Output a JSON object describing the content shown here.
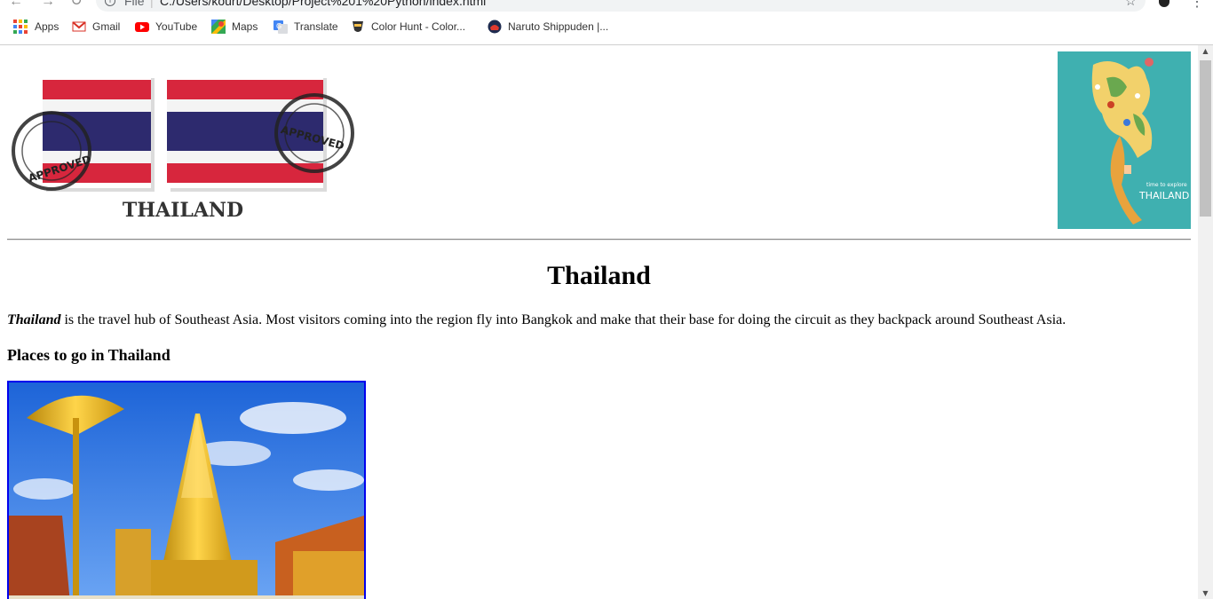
{
  "browser": {
    "omnibox": {
      "scheme_label": "File",
      "separator": "|",
      "url": "C:/Users/kourt/Desktop/Project%201%20Python/index.html"
    },
    "bookmarks": [
      {
        "label": "Apps",
        "icon": "apps-grid-icon"
      },
      {
        "label": "Gmail",
        "icon": "gmail-icon"
      },
      {
        "label": "YouTube",
        "icon": "youtube-icon"
      },
      {
        "label": "Maps",
        "icon": "maps-icon"
      },
      {
        "label": "Translate",
        "icon": "translate-icon"
      },
      {
        "label": "Color Hunt - Color...",
        "icon": "color-hunt-icon"
      },
      {
        "label": "Naruto Shippuden |...",
        "icon": "naruto-icon"
      }
    ]
  },
  "page": {
    "banner_text": "THAILAND",
    "stamp_text": "APPROVED",
    "map_caption_small": "time to explore",
    "map_caption": "THAILAND",
    "title": "Thailand",
    "intro_bold": "Thailand",
    "intro_rest": " is the travel hub of Southeast Asia. Most visitors coming into the region fly into Bangkok and make that their base for doing the circuit as they backpack around Southeast Asia.",
    "section_heading": "Places to go in Thailand"
  },
  "colors": {
    "flag_red": "#d7263d",
    "flag_blue": "#2d2a6e",
    "link_border": "#0000ee",
    "map_background": "#3fb0b0"
  }
}
